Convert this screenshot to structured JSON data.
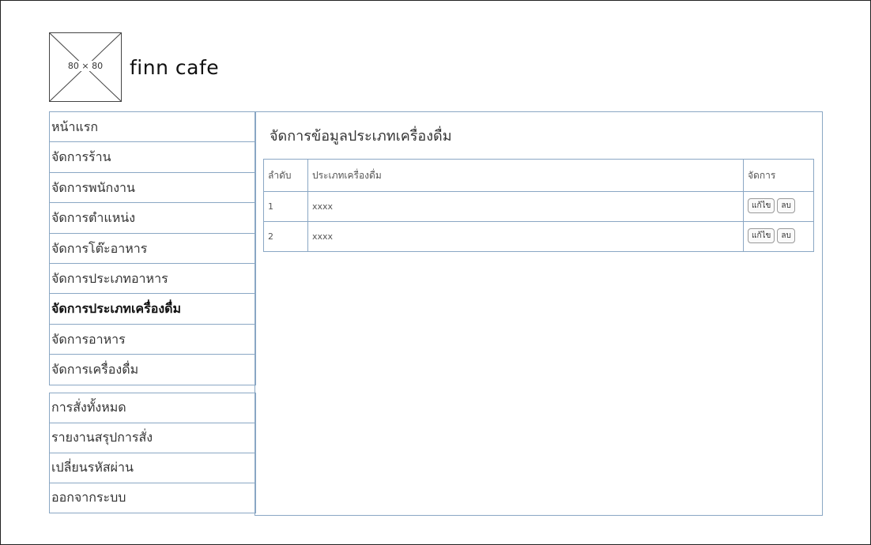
{
  "logo": {
    "placeholder_text": "80 × 80"
  },
  "brand": {
    "name": "finn cafe"
  },
  "sidebar": {
    "group1": [
      {
        "label": "หน้าแรก",
        "active": false
      },
      {
        "label": "จัดการร้าน",
        "active": false
      },
      {
        "label": "จัดการพนักงาน",
        "active": false
      },
      {
        "label": "จัดการตำแหน่ง",
        "active": false
      },
      {
        "label": "จัดการโต๊ะอาหาร",
        "active": false
      },
      {
        "label": "จัดการประเภทอาหาร",
        "active": false
      },
      {
        "label": "จัดการประเภทเครื่องดื่ม",
        "active": true
      },
      {
        "label": "จัดการอาหาร",
        "active": false
      },
      {
        "label": "จัดการเครื่องดื่ม",
        "active": false
      }
    ],
    "group2": [
      {
        "label": "การสั่งทั้งหมด"
      },
      {
        "label": "รายงานสรุปการสั่ง"
      },
      {
        "label": "เปลี่ยนรหัสผ่าน"
      },
      {
        "label": "ออกจากระบบ"
      }
    ]
  },
  "main": {
    "title": "จัดการข้อมูลประเภทเครื่องดื่ม",
    "table": {
      "headers": [
        "ลำดับ",
        "ประเภทเครื่องดื่ม",
        "จัดการ"
      ],
      "rows": [
        {
          "no": "1",
          "name": "xxxx",
          "edit_label": "แก้ไข",
          "delete_label": "ลบ"
        },
        {
          "no": "2",
          "name": "xxxx",
          "edit_label": "แก้ไข",
          "delete_label": "ลบ"
        }
      ]
    }
  }
}
